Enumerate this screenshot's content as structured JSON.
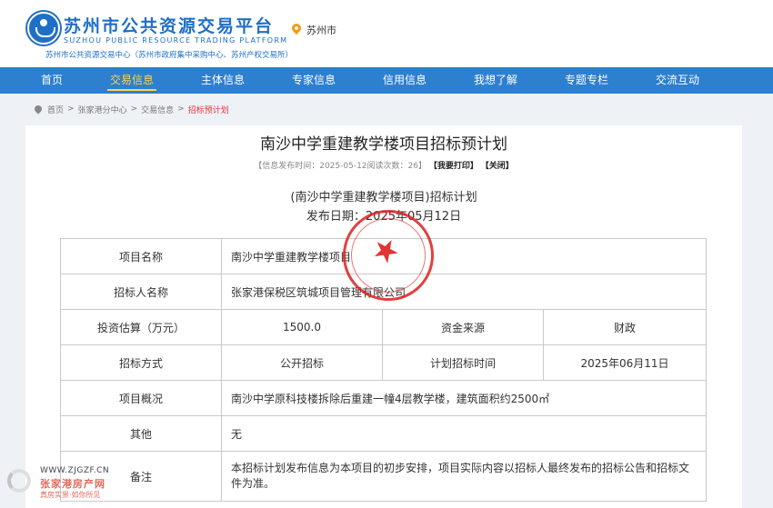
{
  "header": {
    "site_title": "苏州市公共资源交易平台",
    "site_title_en": "SUZHOU PUBLIC RESOURCE TRADING PLATFORM",
    "site_subtitle": "苏州市公共资源交易中心（苏州市政府集中采购中心、苏州产权交易所）",
    "city": "苏州市"
  },
  "nav": {
    "items": [
      {
        "label": "首页"
      },
      {
        "label": "交易信息",
        "active": true
      },
      {
        "label": "主体信息"
      },
      {
        "label": "专家信息"
      },
      {
        "label": "信用信息"
      },
      {
        "label": "我想了解"
      },
      {
        "label": "专题专栏"
      },
      {
        "label": "交流互动"
      }
    ]
  },
  "breadcrumb": {
    "items": [
      "首页",
      "张家港分中心",
      "交易信息",
      "招标预计划"
    ],
    "separator": ">"
  },
  "article": {
    "title": "南沙中学重建教学楼项目招标预计划",
    "meta_prefix": "【信息发布时间：2025-05-12阅读次数：26】",
    "print_label": "【我要打印】",
    "close_label": "【关闭】",
    "sub_title": "(南沙中学重建教学楼项目)招标计划",
    "publish_date": "发布日期：2025年05月12日"
  },
  "table": {
    "project_name_label": "项目名称",
    "project_name": "南沙中学重建教学楼项目",
    "tenderer_label": "招标人名称",
    "tenderer": "张家港保税区筑城项目管理有限公司",
    "investment_label": "投资估算（万元）",
    "investment": "1500.0",
    "fund_source_label": "资金来源",
    "fund_source": "财政",
    "method_label": "招标方式",
    "method": "公开招标",
    "plan_time_label": "计划招标时间",
    "plan_time": "2025年06月11日",
    "overview_label": "项目概况",
    "overview": "南沙中学原科技楼拆除后重建一幢4层教学楼，建筑面积约2500㎡",
    "other_label": "其他",
    "other": "无",
    "remark_label": "备注",
    "remark": "本招标计划发布信息为本项目的初步安排，项目实际内容以招标人最终发布的招标公告和招标文件为准。"
  },
  "watermark": {
    "url": "WWW.ZJGZF.CN",
    "name": "张家港房产网",
    "slogan": "真房实景·如你所见"
  },
  "colors": {
    "brand_blue": "#2d7fd0",
    "nav_active": "#ffd34a",
    "seal_red": "#de1e1e",
    "breadcrumb_current": "#e4393c"
  }
}
